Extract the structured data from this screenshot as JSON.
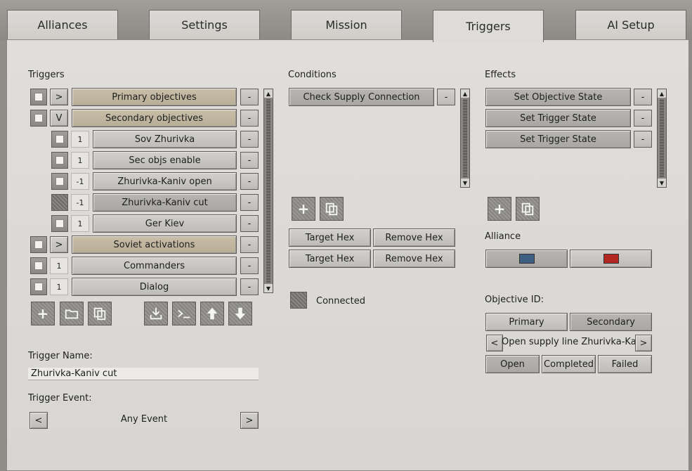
{
  "tabs": [
    {
      "label": "Alliances"
    },
    {
      "label": "Settings"
    },
    {
      "label": "Mission"
    },
    {
      "label": "Triggers"
    },
    {
      "label": "AI Setup"
    }
  ],
  "triggers": {
    "heading": "Triggers",
    "rows": [
      {
        "toggle": ">",
        "num": "",
        "label": "Primary objectives",
        "indent": 0,
        "kind": "group"
      },
      {
        "toggle": "V",
        "num": "",
        "label": "Secondary objectives",
        "indent": 0,
        "kind": "group"
      },
      {
        "toggle": "",
        "num": "1",
        "label": "Sov Zhurivka",
        "indent": 1,
        "kind": "item"
      },
      {
        "toggle": "",
        "num": "1",
        "label": "Sec objs enable",
        "indent": 1,
        "kind": "item"
      },
      {
        "toggle": "",
        "num": "-1",
        "label": "Zhurivka-Kaniv open",
        "indent": 1,
        "kind": "item"
      },
      {
        "toggle": "",
        "num": "-1",
        "label": "Zhurivka-Kaniv cut",
        "indent": 1,
        "kind": "selected"
      },
      {
        "toggle": "",
        "num": "1",
        "label": "Ger Kiev",
        "indent": 1,
        "kind": "item"
      },
      {
        "toggle": ">",
        "num": "",
        "label": "Soviet activations",
        "indent": 0,
        "kind": "group"
      },
      {
        "toggle": "",
        "num": "1",
        "label": "Commanders",
        "indent": 0,
        "kind": "item"
      },
      {
        "toggle": "",
        "num": "1",
        "label": "Dialog",
        "indent": 0,
        "kind": "item"
      }
    ],
    "minus_label": "-",
    "name_label": "Trigger Name:",
    "name_value": "Zhurivka-Kaniv cut",
    "event_label": "Trigger Event:",
    "event_value": "Any Event",
    "prev": "<",
    "next": ">"
  },
  "conditions": {
    "heading": "Conditions",
    "items": [
      "Check Supply Connection"
    ],
    "hex_buttons": [
      [
        "Target Hex",
        "Remove Hex"
      ],
      [
        "Target Hex",
        "Remove Hex"
      ]
    ],
    "connected_label": "Connected"
  },
  "effects": {
    "heading": "Effects",
    "items": [
      "Set Objective State",
      "Set Trigger State",
      "Set Trigger State"
    ],
    "alliance_label": "Alliance",
    "alliance_colors": [
      "#3f5f82",
      "#b32822"
    ],
    "objective_label": "Objective ID:",
    "objective_types": [
      "Primary",
      "Secondary"
    ],
    "objective_name": "Open supply line Zhurivka-Kaniv",
    "states": [
      "Open",
      "Completed",
      "Failed"
    ]
  },
  "icons": [
    "plus-icon",
    "folder-icon",
    "copy-icon",
    "import-icon",
    "console-icon",
    "arrow-up-icon",
    "arrow-down-icon"
  ]
}
